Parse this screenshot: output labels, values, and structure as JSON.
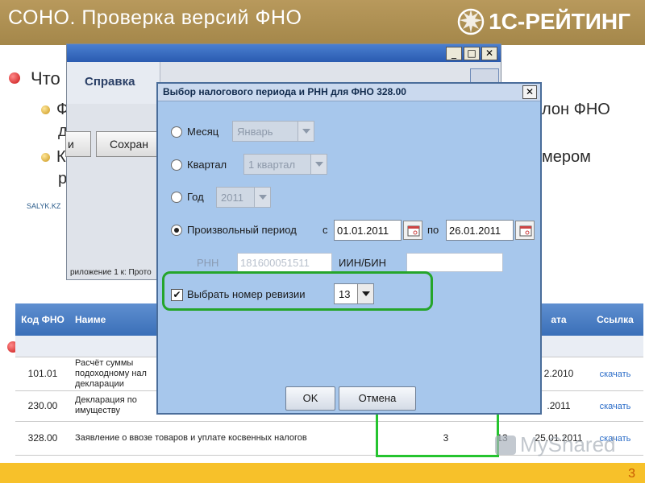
{
  "slide": {
    "title": "СОНО. Проверка версий ФНО",
    "logo_text": "1С-РЕЙТИНГ",
    "page_number": "3",
    "bullet_main": "Что",
    "bullet_sub1_left": "Ф",
    "bullet_sub1_left2": "д",
    "bullet_sub1_right": "лон ФНО",
    "bullet_sub2_left": "К",
    "bullet_sub2_left2": "р",
    "bullet_sub2_right": "мером",
    "site_label": "SALYK.KZ",
    "watermark": "MyShared"
  },
  "bg_window": {
    "menu_label": "Справка",
    "btn_left_label": "и",
    "btn_save_label": "Сохран",
    "minimize_icon": "_",
    "maximize_icon": "□",
    "close_icon": "✕",
    "caption": "риложение 1 к: Прото"
  },
  "table": {
    "headers": [
      "Код ФНО",
      "Наиме",
      "",
      "",
      "ата",
      "Ссылка"
    ],
    "rows": [
      {
        "code": "101.01",
        "name_lines": [
          "Расчёт суммы",
          "подоходному нал",
          "декларации"
        ],
        "col3": "",
        "col4": "",
        "date": "2.2010",
        "link": "скачать"
      },
      {
        "code": "230.00",
        "name_lines": [
          "Декларация по",
          "имуществу"
        ],
        "col3": "",
        "col4": "",
        "date": ".2011",
        "link": "скачать"
      },
      {
        "code": "328.00",
        "name_lines": [
          "Заявление о ввозе товаров и уплате косвенных налогов"
        ],
        "col3": "3",
        "col4": "13",
        "date": "25.01.2011",
        "link": "скачать"
      }
    ]
  },
  "dialog": {
    "title": "Выбор налогового периода и РНН для ФНО 328.00",
    "close_icon": "✕",
    "month_label": "Месяц",
    "month_value": "Январь",
    "quarter_label": "Квартал",
    "quarter_value": "1 квартал",
    "year_label": "Год",
    "year_value": "2011",
    "custom_period_label": "Произвольный период",
    "from_label": "с",
    "from_value": "01.01.2011",
    "to_label": "по",
    "to_value": "26.01.2011",
    "rnn_label": "РНН",
    "rnn_value": "181600051511",
    "iin_label": "ИИН/БИН",
    "iin_value": "",
    "revision_label": "Выбрать номер ревизии",
    "revision_value": "13",
    "ok_label": "OK",
    "cancel_label": "Отмена",
    "selected_period": "custom",
    "revision_checked": true
  },
  "colors": {
    "header_bg": "#a4874a",
    "dialog_bg": "#a7c7ec",
    "highlight": "#25a52a",
    "footer": "#f7c12a",
    "link": "#2a6cc8"
  },
  "icons": [
    "logo-mark-icon",
    "calendar-icon",
    "chevron-down-icon",
    "checkmark-icon",
    "close-icon",
    "radio-icon",
    "bullet-icon",
    "chart-icon"
  ]
}
